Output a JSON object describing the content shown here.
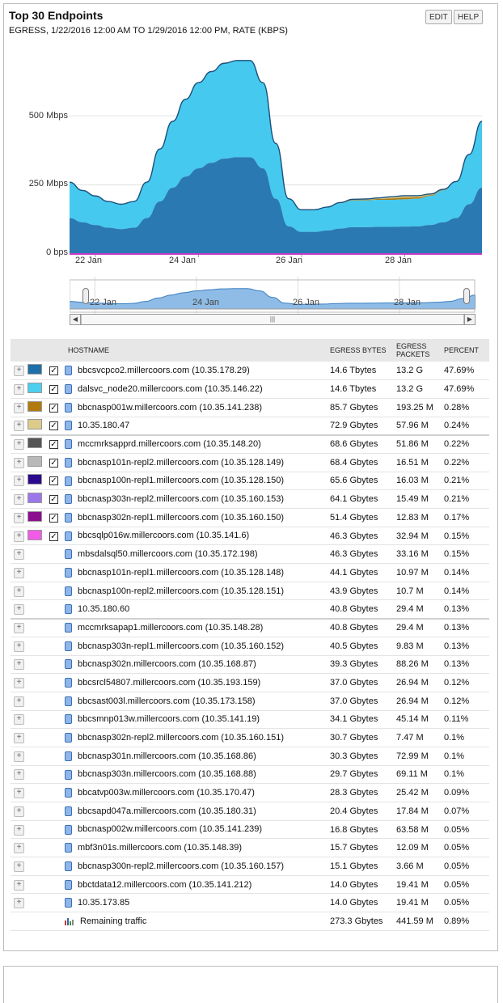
{
  "header": {
    "title": "Top 30 Endpoints",
    "subtitle": "EGRESS, 1/22/2016 12:00 AM TO 1/29/2016 12:00 PM, RATE (KBPS)",
    "edit_label": "EDIT",
    "help_label": "HELP"
  },
  "chart_data": {
    "type": "area",
    "title": "",
    "xlabel": "",
    "ylabel": "",
    "x": [
      "21 Jan 12:00",
      "21 Jan 18:00",
      "22 Jan 00:00",
      "22 Jan 06:00",
      "22 Jan 12:00",
      "22 Jan 18:00",
      "23 Jan 00:00",
      "23 Jan 06:00",
      "23 Jan 12:00",
      "23 Jan 18:00",
      "24 Jan 00:00",
      "24 Jan 06:00",
      "24 Jan 12:00",
      "24 Jan 18:00",
      "25 Jan 00:00",
      "25 Jan 06:00",
      "25 Jan 12:00",
      "25 Jan 18:00",
      "26 Jan 00:00",
      "26 Jan 06:00",
      "26 Jan 12:00",
      "26 Jan 18:00",
      "27 Jan 00:00",
      "27 Jan 06:00",
      "27 Jan 12:00",
      "27 Jan 18:00",
      "28 Jan 00:00",
      "28 Jan 06:00",
      "28 Jan 12:00",
      "28 Jan 18:00",
      "29 Jan 00:00",
      "29 Jan 06:00",
      "29 Jan 12:00"
    ],
    "series": [
      {
        "name": "bbcsvcpco2.millercoors.com (10.35.178.29)",
        "color": "#2a79b3",
        "values": [
          130,
          115,
          105,
          95,
          90,
          95,
          130,
          190,
          240,
          280,
          310,
          330,
          345,
          350,
          350,
          310,
          200,
          100,
          80,
          80,
          85,
          92,
          97,
          97,
          98,
          98,
          99,
          100,
          105,
          115,
          130,
          180,
          240
        ]
      },
      {
        "name": "dalsvc_node20.millercoors.com (10.35.146.22)",
        "color": "#46c9ee",
        "values": [
          130,
          115,
          105,
          95,
          90,
          95,
          130,
          190,
          240,
          280,
          310,
          330,
          345,
          350,
          350,
          310,
          200,
          100,
          80,
          80,
          85,
          92,
          97,
          97,
          98,
          98,
          99,
          100,
          105,
          115,
          130,
          180,
          240
        ]
      },
      {
        "name": "bbcnasp001w.millercoors.com (10.35.141.238)",
        "color": "#b07a10",
        "values": [
          0,
          0,
          0,
          0,
          0,
          0,
          0,
          0,
          0,
          0,
          0,
          0,
          0,
          0,
          0,
          0,
          0,
          0,
          0,
          0,
          0,
          1,
          2,
          2,
          3,
          5,
          6,
          5,
          3,
          2,
          1,
          0,
          0
        ]
      },
      {
        "name": "10.35.180.47",
        "color": "#dccb8a",
        "values": [
          0,
          0,
          0,
          0,
          0,
          0,
          0,
          0,
          0,
          0,
          0,
          0,
          0,
          0,
          0,
          0,
          0,
          0,
          0,
          0,
          0,
          1,
          2,
          3,
          4,
          6,
          7,
          6,
          4,
          2,
          1,
          0,
          0
        ]
      }
    ],
    "ylim": [
      0,
      720
    ],
    "y_ticks": [
      "0 bps",
      "250 Mbps",
      "500 Mbps"
    ],
    "y_tick_values": [
      0,
      250,
      500
    ],
    "x_ticks": [
      "22 Jan",
      "24 Jan",
      "26 Jan",
      "28 Jan"
    ],
    "x_tick_values": [
      2,
      10,
      18,
      26
    ],
    "navigator_ticks": [
      "22 Jan",
      "24 Jan",
      "26 Jan",
      "28 Jan"
    ],
    "legend": "table",
    "grid": true
  },
  "table": {
    "headers": {
      "hostname": "HOSTNAME",
      "bytes": "EGRESS BYTES",
      "packets": "EGRESS PACKETS",
      "percent": "PERCENT"
    },
    "rows": [
      {
        "host": "bbcsvcpco2.millercoors.com (10.35.178.29)",
        "bytes": "14.6 Tbytes",
        "packets": "13.2 G",
        "percent": "47.69%",
        "color": "#1f6fa8",
        "checked": true
      },
      {
        "host": "dalsvc_node20.millercoors.com (10.35.146.22)",
        "bytes": "14.6 Tbytes",
        "packets": "13.2 G",
        "percent": "47.69%",
        "color": "#4ccfef",
        "checked": true
      },
      {
        "host": "bbcnasp001w.millercoors.com (10.35.141.238)",
        "bytes": "85.7 Gbytes",
        "packets": "193.25 M",
        "percent": "0.28%",
        "color": "#b07a10",
        "checked": true
      },
      {
        "host": "10.35.180.47",
        "bytes": "72.9 Gbytes",
        "packets": "57.96 M",
        "percent": "0.24%",
        "color": "#dccb8a",
        "checked": true
      },
      {
        "host": "mccmrksapprd.millercoors.com (10.35.148.20)",
        "bytes": "68.6 Gbytes",
        "packets": "51.86 M",
        "percent": "0.22%",
        "color": "#555555",
        "checked": true
      },
      {
        "host": "bbcnasp101n-repl2.millercoors.com (10.35.128.149)",
        "bytes": "68.4 Gbytes",
        "packets": "16.51 M",
        "percent": "0.22%",
        "color": "#b9b9b9",
        "checked": true
      },
      {
        "host": "bbcnasp100n-repl1.millercoors.com (10.35.128.150)",
        "bytes": "65.6 Gbytes",
        "packets": "16.03 M",
        "percent": "0.21%",
        "color": "#2b0a8e",
        "checked": true
      },
      {
        "host": "bbcnasp303n-repl2.millercoors.com (10.35.160.153)",
        "bytes": "64.1 Gbytes",
        "packets": "15.49 M",
        "percent": "0.21%",
        "color": "#9b77ea",
        "checked": true
      },
      {
        "host": "bbcnasp302n-repl1.millercoors.com (10.35.160.150)",
        "bytes": "51.4 Gbytes",
        "packets": "12.83 M",
        "percent": "0.17%",
        "color": "#8b0f8f",
        "checked": true
      },
      {
        "host": "bbcsqlp016w.millercoors.com (10.35.141.6)",
        "bytes": "46.3 Gbytes",
        "packets": "32.94 M",
        "percent": "0.15%",
        "color": "#f05ce6",
        "checked": true
      },
      {
        "host": "mbsdalsql50.millercoors.com (10.35.172.198)",
        "bytes": "46.3 Gbytes",
        "packets": "33.16 M",
        "percent": "0.15%",
        "color": "",
        "checked": false
      },
      {
        "host": "bbcnasp101n-repl1.millercoors.com (10.35.128.148)",
        "bytes": "44.1 Gbytes",
        "packets": "10.97 M",
        "percent": "0.14%",
        "color": "",
        "checked": false
      },
      {
        "host": "bbcnasp100n-repl2.millercoors.com (10.35.128.151)",
        "bytes": "43.9 Gbytes",
        "packets": "10.7 M",
        "percent": "0.14%",
        "color": "",
        "checked": false
      },
      {
        "host": "10.35.180.60",
        "bytes": "40.8 Gbytes",
        "packets": "29.4 M",
        "percent": "0.13%",
        "color": "",
        "checked": false
      },
      {
        "host": "mccmrksapap1.millercoors.com (10.35.148.28)",
        "bytes": "40.8 Gbytes",
        "packets": "29.4 M",
        "percent": "0.13%",
        "color": "",
        "checked": false
      },
      {
        "host": "bbcnasp303n-repl1.millercoors.com (10.35.160.152)",
        "bytes": "40.5 Gbytes",
        "packets": "9.83 M",
        "percent": "0.13%",
        "color": "",
        "checked": false
      },
      {
        "host": "bbcnasp302n.millercoors.com (10.35.168.87)",
        "bytes": "39.3 Gbytes",
        "packets": "88.26 M",
        "percent": "0.13%",
        "color": "",
        "checked": false
      },
      {
        "host": "bbcsrcl54807.millercoors.com (10.35.193.159)",
        "bytes": "37.0 Gbytes",
        "packets": "26.94 M",
        "percent": "0.12%",
        "color": "",
        "checked": false
      },
      {
        "host": "bbcsast003l.millercoors.com (10.35.173.158)",
        "bytes": "37.0 Gbytes",
        "packets": "26.94 M",
        "percent": "0.12%",
        "color": "",
        "checked": false
      },
      {
        "host": "bbcsmnp013w.millercoors.com (10.35.141.19)",
        "bytes": "34.1 Gbytes",
        "packets": "45.14 M",
        "percent": "0.11%",
        "color": "",
        "checked": false
      },
      {
        "host": "bbcnasp302n-repl2.millercoors.com (10.35.160.151)",
        "bytes": "30.7 Gbytes",
        "packets": "7.47 M",
        "percent": "0.1%",
        "color": "",
        "checked": false
      },
      {
        "host": "bbcnasp301n.millercoors.com (10.35.168.86)",
        "bytes": "30.3 Gbytes",
        "packets": "72.99 M",
        "percent": "0.1%",
        "color": "",
        "checked": false
      },
      {
        "host": "bbcnasp303n.millercoors.com (10.35.168.88)",
        "bytes": "29.7 Gbytes",
        "packets": "69.11 M",
        "percent": "0.1%",
        "color": "",
        "checked": false
      },
      {
        "host": "bbcatvp003w.millercoors.com (10.35.170.47)",
        "bytes": "28.3 Gbytes",
        "packets": "25.42 M",
        "percent": "0.09%",
        "color": "",
        "checked": false
      },
      {
        "host": "bbcsapd047a.millercoors.com (10.35.180.31)",
        "bytes": "20.4 Gbytes",
        "packets": "17.84 M",
        "percent": "0.07%",
        "color": "",
        "checked": false
      },
      {
        "host": "bbcnasp002w.millercoors.com (10.35.141.239)",
        "bytes": "16.8 Gbytes",
        "packets": "63.58 M",
        "percent": "0.05%",
        "color": "",
        "checked": false
      },
      {
        "host": "mbf3n01s.millercoors.com (10.35.148.39)",
        "bytes": "15.7 Gbytes",
        "packets": "12.09 M",
        "percent": "0.05%",
        "color": "",
        "checked": false
      },
      {
        "host": "bbcnasp300n-repl2.millercoors.com (10.35.160.157)",
        "bytes": "15.1 Gbytes",
        "packets": "3.66 M",
        "percent": "0.05%",
        "color": "",
        "checked": false
      },
      {
        "host": "bbctdata12.millercoors.com (10.35.141.212)",
        "bytes": "14.0 Gbytes",
        "packets": "19.41 M",
        "percent": "0.05%",
        "color": "",
        "checked": false
      },
      {
        "host": "10.35.173.85",
        "bytes": "14.0 Gbytes",
        "packets": "19.41 M",
        "percent": "0.05%",
        "color": "",
        "checked": false
      }
    ],
    "remaining": {
      "host": "Remaining traffic",
      "bytes": "273.3 Gbytes",
      "packets": "441.59 M",
      "percent": "0.89%"
    }
  }
}
